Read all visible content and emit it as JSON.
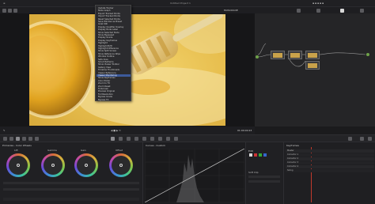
{
  "window": {
    "title": "Untitled Project 1",
    "clip_name": "MUSC00.DE"
  },
  "viewer": {
    "timecode": "01:00:00:23"
  },
  "menu": {
    "items": [
      "Update Tracker",
      "Node Graph",
      "Export Tracked Points",
      "Import Tracked Points",
      "Reset Selected Points",
      "Save Window as Preset",
      "Grab Still",
      "Display Qualifier Overlay",
      "Display Node Label",
      "Show Selected Node",
      "Show Bypassed",
      "Display Grade",
      "Display Keyframes",
      "Highlight",
      "Highlight B/W",
      "Highlight Difference",
      "Show Split Screen",
      "Show Reference Wipe",
      "Window Outline",
      "Safe Area",
      "Smart Reframe",
      "Show Viewer Toolbar",
      "Gallery View",
      "Timeline Thumbnails",
      "Viewer Reference",
      "Viewer Monitoring",
      "Show Keyframes",
      "Color Picker",
      "Zoom to Fit",
      "Zoom Reset",
      "Fullscreen",
      "Preview Original",
      "Full Resolution",
      "Bypass Grade",
      "Bypass FX"
    ],
    "highlighted_index": 25
  },
  "panels": {
    "wheels": {
      "title": "Primaries - Color Wheels",
      "labels": [
        "Lift",
        "Gamma",
        "Gain",
        "Offset"
      ]
    },
    "curves": {
      "title": "Curves - Custom"
    },
    "curve_controls": {
      "title": "Edit",
      "soft_clip": "Soft Clip"
    },
    "keyframes": {
      "title": "Keyframes",
      "tracks": [
        "Master",
        "Corrector 1",
        "Corrector 2",
        "Corrector 3",
        "Corrector 4",
        "Sizing"
      ]
    }
  },
  "colors": {
    "accent": "#3d5a9a",
    "playhead": "#c0392b",
    "node_border": "#6a6a6a"
  },
  "icons": [
    "play-icon",
    "stop-icon",
    "loop-icon",
    "gear-icon",
    "wheel-icon",
    "curve-icon",
    "node-icon"
  ]
}
